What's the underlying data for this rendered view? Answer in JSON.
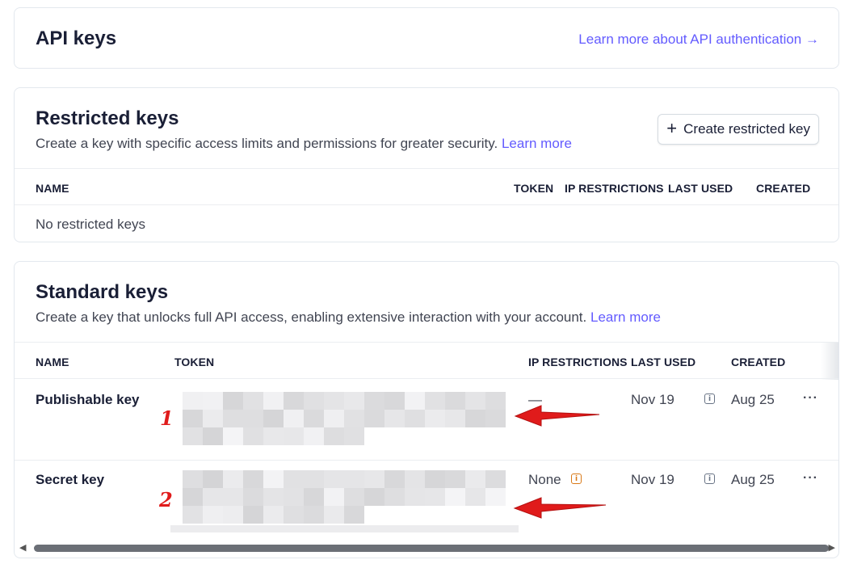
{
  "header": {
    "title": "API keys",
    "learn_link": "Learn more about API authentication →"
  },
  "restricted": {
    "title": "Restricted keys",
    "subtitle": "Create a key with specific access limits and permissions for greater security.",
    "learn_more": "Learn more",
    "create_button": "Create restricted key",
    "columns": [
      "NAME",
      "TOKEN",
      "IP RESTRICTIONS",
      "LAST USED",
      "CREATED"
    ],
    "empty_text": "No restricted keys"
  },
  "standard": {
    "title": "Standard keys",
    "subtitle": "Create a key that unlocks full API access, enabling extensive interaction with your account.",
    "learn_more": "Learn more",
    "columns": [
      "NAME",
      "TOKEN",
      "IP RESTRICTIONS",
      "LAST USED",
      "CREATED"
    ],
    "rows": [
      {
        "name": "Publishable key",
        "ip": "—",
        "last_used": "Nov 19",
        "created": "Aug 25"
      },
      {
        "name": "Secret key",
        "ip": "None",
        "last_used": "Nov 19",
        "created": "Aug 25"
      }
    ],
    "more_label": "···"
  },
  "annotations": [
    "1",
    "2"
  ],
  "colors": {
    "accent": "#635bff",
    "annotation": "#e01b1b",
    "warning": "#d97917"
  }
}
